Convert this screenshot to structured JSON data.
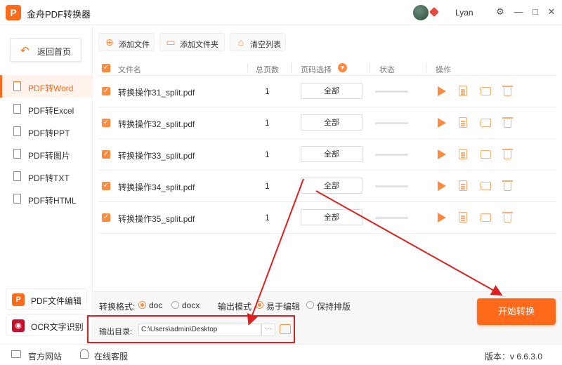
{
  "app": {
    "title": "金舟PDF转换器",
    "logo_letter": "P",
    "username": "Lyan"
  },
  "window_controls": {
    "settings": "⚙",
    "minimize": "—",
    "maximize": "□",
    "close": "✕"
  },
  "sidebar": {
    "home_label": "返回首页",
    "items": [
      {
        "label": "PDF转Word",
        "active": true
      },
      {
        "label": "PDF转Excel",
        "active": false
      },
      {
        "label": "PDF转PPT",
        "active": false
      },
      {
        "label": "PDF转图片",
        "active": false
      },
      {
        "label": "PDF转TXT",
        "active": false
      },
      {
        "label": "PDF转HTML",
        "active": false
      }
    ],
    "tools": [
      {
        "label": "PDF文件编辑",
        "icon": "P",
        "color": "#ff6a1a"
      },
      {
        "label": "OCR文字识别",
        "icon": "◉",
        "color": "#c8102e"
      }
    ]
  },
  "toolbar": {
    "add_file": "添加文件",
    "add_folder": "添加文件夹",
    "clear_list": "清空列表"
  },
  "table": {
    "headers": {
      "name": "文件名",
      "pages": "总页数",
      "range": "页码选择",
      "status": "状态",
      "actions": "操作"
    },
    "rows": [
      {
        "name": "转换操作31_split.pdf",
        "pages": "1",
        "range": "全部",
        "progress": 0
      },
      {
        "name": "转换操作32_split.pdf",
        "pages": "1",
        "range": "全部",
        "progress": 0
      },
      {
        "name": "转换操作33_split.pdf",
        "pages": "1",
        "range": "全部",
        "progress": 0
      },
      {
        "name": "转换操作34_split.pdf",
        "pages": "1",
        "range": "全部",
        "progress": 0
      },
      {
        "name": "转换操作35_split.pdf",
        "pages": "1",
        "range": "全部",
        "progress": 0
      }
    ]
  },
  "options": {
    "format_label": "转换格式:",
    "formats": [
      {
        "label": "doc",
        "selected": true
      },
      {
        "label": "docx",
        "selected": false
      }
    ],
    "mode_label": "输出模式",
    "modes": [
      {
        "label": "易于编辑",
        "selected": true
      },
      {
        "label": "保持排版",
        "selected": false
      }
    ],
    "output_label": "输出目录:",
    "output_path": "C:\\Users\\admin\\Desktop",
    "browse_label": "···"
  },
  "start_label": "开始转换",
  "statusbar": {
    "website": "官方网站",
    "support": "在线客服",
    "version": "版本：v 6.6.3.0"
  },
  "colors": {
    "accent": "#ff6a1a",
    "annotation": "#e02020"
  }
}
